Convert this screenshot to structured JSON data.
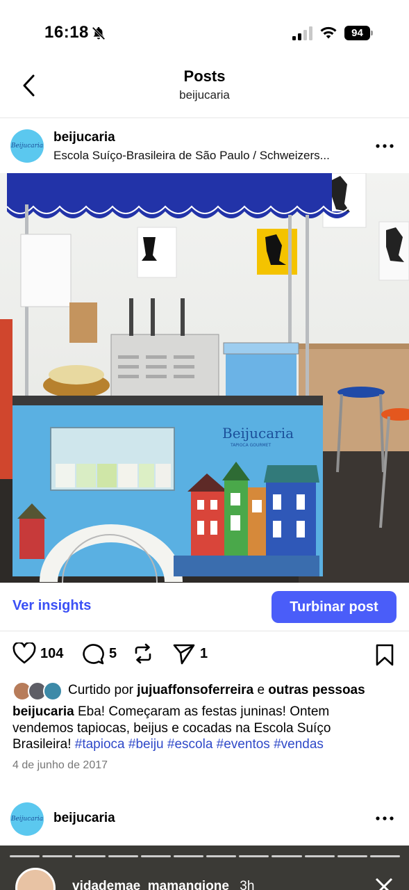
{
  "status_bar": {
    "time": "16:18",
    "battery": "94",
    "icons": [
      "bell-slash-icon",
      "signal-icon",
      "wifi-icon",
      "battery-icon"
    ]
  },
  "nav": {
    "title": "Posts",
    "subtitle": "beijucaria",
    "back_icon": "chevron-left-icon"
  },
  "post": {
    "username": "beijucaria",
    "location": "Escola Suíço-Brasileira de São Paulo / Schweizers...",
    "avatar_text": "Beijucaria",
    "photo": {
      "cart_brand_text": "Beijucaria",
      "cart_tagline": "TAPIOCA GOURMET"
    },
    "insights_label": "Ver insights",
    "boost_label": "Turbinar post",
    "likes_count": "104",
    "comments_count": "5",
    "shares_count": "1",
    "liked_by_prefix": "Curtido por",
    "liked_by_user": "jujuaffonsoferreira",
    "liked_by_and": "e",
    "liked_by_others": "outras pessoas",
    "caption_user": "beijucaria",
    "caption_text": "Eba! Começaram as festas juninas! Ontem vendemos tapiocas, beijus e cocadas na Escola Suíço Brasileira!",
    "hashtags": [
      "#tapioca",
      "#beiju",
      "#escola",
      "#eventos",
      "#vendas"
    ],
    "date": "4 de junho de 2017"
  },
  "post2": {
    "username": "beijucaria",
    "avatar_text": "Beijucaria",
    "story_user": "vidademae_mamangione",
    "story_time": "3h"
  },
  "colors": {
    "accent": "#4a5df9",
    "link": "#3b50f5",
    "hashtag": "#2f49c8",
    "avatar_bg": "#5bc8ef"
  }
}
